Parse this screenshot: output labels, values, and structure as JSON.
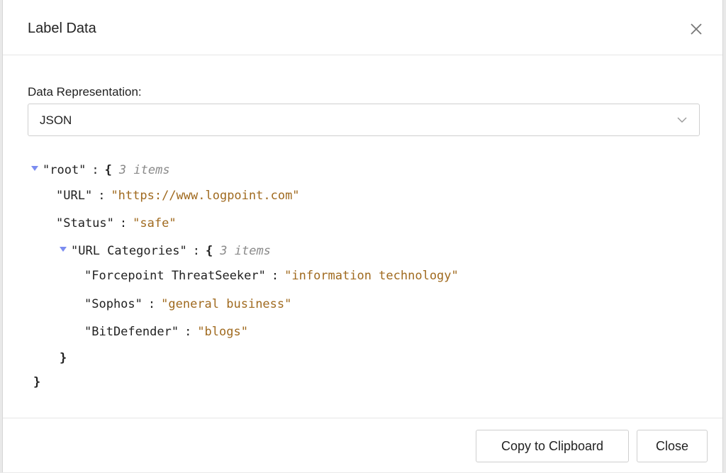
{
  "dialog": {
    "title": "Label Data",
    "close_icon": "close-icon"
  },
  "representation": {
    "label": "Data Representation:",
    "selected": "JSON",
    "chevron_icon": "chevron-down-icon"
  },
  "json_tree": {
    "root_key": "\"root\"",
    "root_open": "{",
    "root_count": "3 items",
    "url_key": "\"URL\"",
    "url_value": "\"https://www.logpoint.com\"",
    "status_key": "\"Status\"",
    "status_value": "\"safe\"",
    "categories_key": "\"URL Categories\"",
    "categories_open": "{",
    "categories_count": "3 items",
    "forcepoint_key": "\"Forcepoint ThreatSeeker\"",
    "forcepoint_value": "\"information technology\"",
    "sophos_key": "\"Sophos\"",
    "sophos_value": "\"general business\"",
    "bitdefender_key": "\"BitDefender\"",
    "bitdefender_value": "\"blogs\"",
    "categories_close": "}",
    "root_close": "}",
    "colon": ":"
  },
  "footer": {
    "copy_label": "Copy to Clipboard",
    "close_label": "Close"
  },
  "colors": {
    "string_value": "#a06a1f",
    "toggle": "#7b8cf0",
    "count_text": "#8a8a8a"
  }
}
